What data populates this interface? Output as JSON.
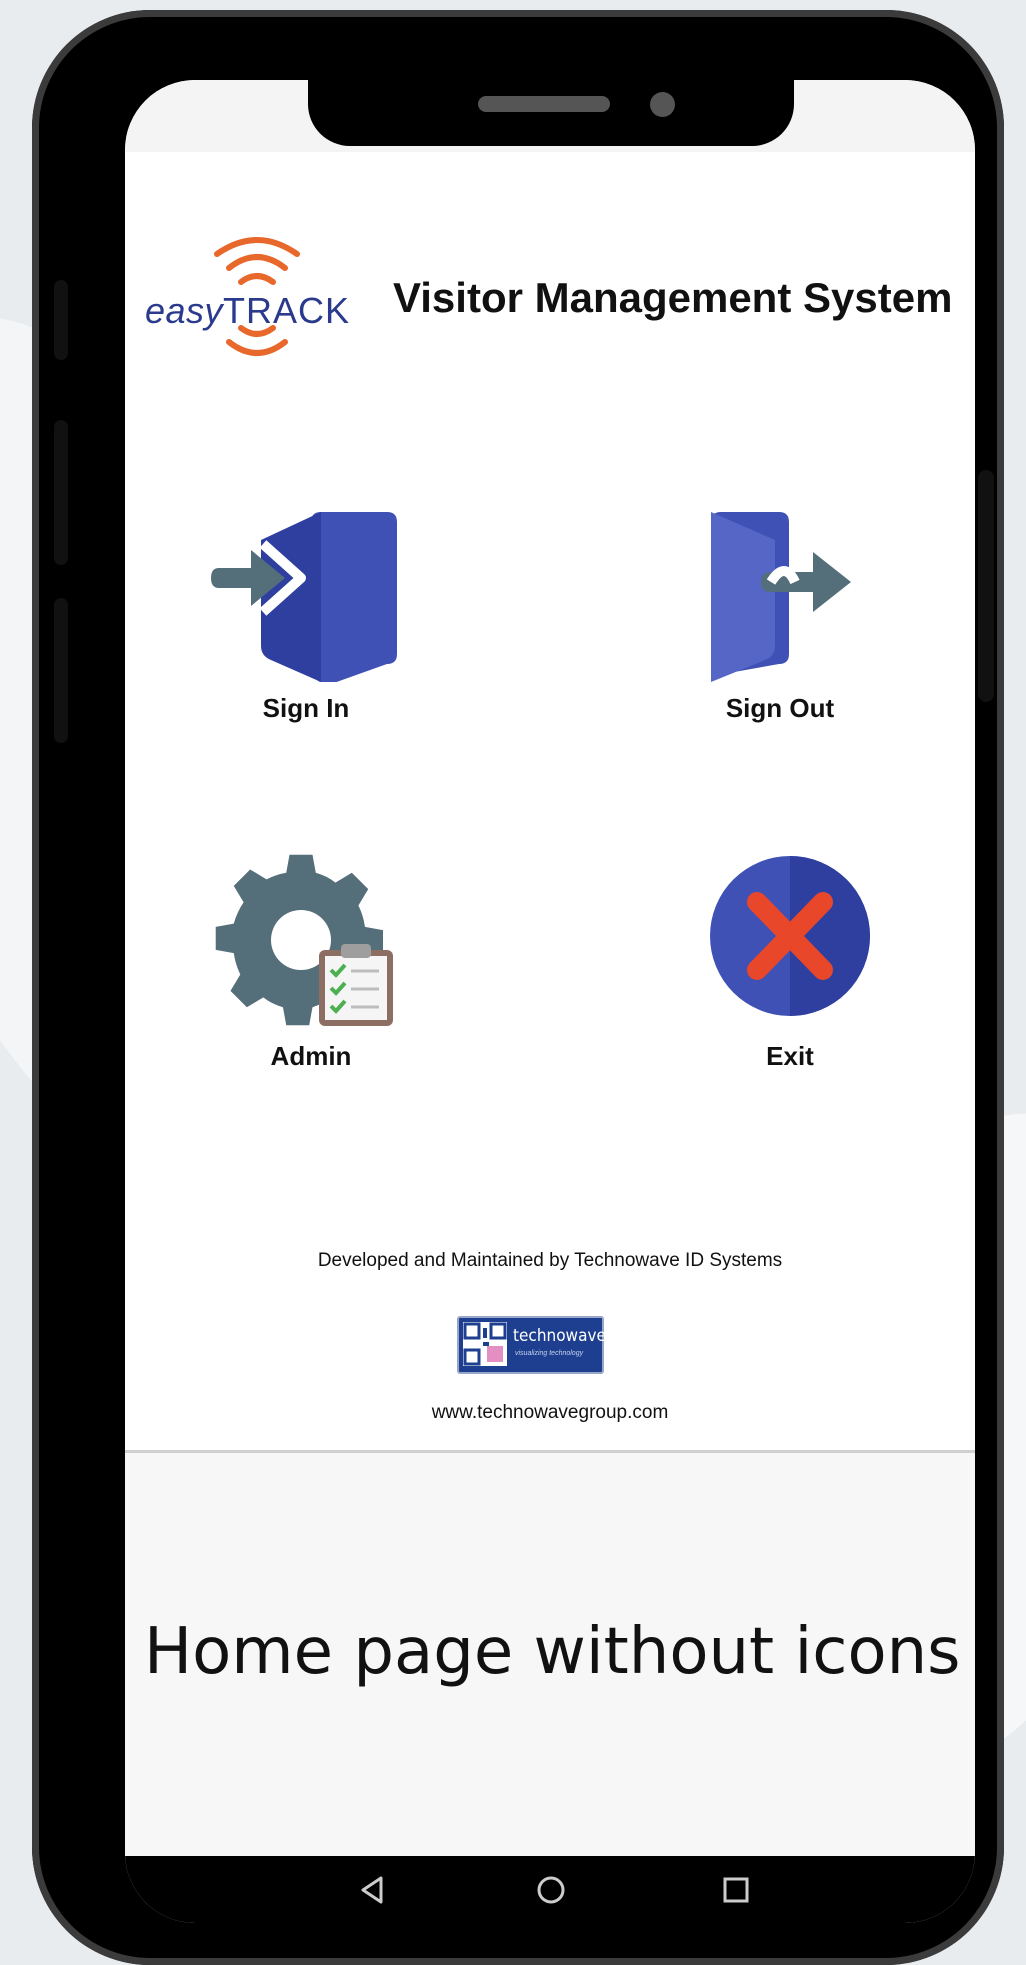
{
  "header": {
    "logo_prefix": "easy",
    "logo_suffix": "TRACK",
    "title": "Visitor Management System"
  },
  "menu": [
    {
      "id": "sign_in",
      "label": "Sign In",
      "icon": "sign-in-door-icon"
    },
    {
      "id": "sign_out",
      "label": "Sign Out",
      "icon": "sign-out-door-icon"
    },
    {
      "id": "admin",
      "label": "Admin",
      "icon": "gear-clipboard-icon"
    },
    {
      "id": "exit",
      "label": "Exit",
      "icon": "close-circle-icon"
    }
  ],
  "footer": {
    "developed_by": "Developed and Maintained by Technowave ID Systems",
    "brand_name": "technowave",
    "brand_tagline": "visualizing technology",
    "website": "www.technowavegroup.com"
  },
  "caption": "Home page without icons",
  "navbar": {
    "back_icon": "back-triangle-icon",
    "home_icon": "home-circle-icon",
    "recents_icon": "recents-square-icon"
  },
  "colors": {
    "logo_blue": "#2a3a8c",
    "logo_orange": "#e8672a",
    "door_blue": "#3f51b5",
    "arrow_gray": "#546e7a",
    "exit_red": "#e8472a",
    "brand_blue": "#1e3f8f"
  }
}
